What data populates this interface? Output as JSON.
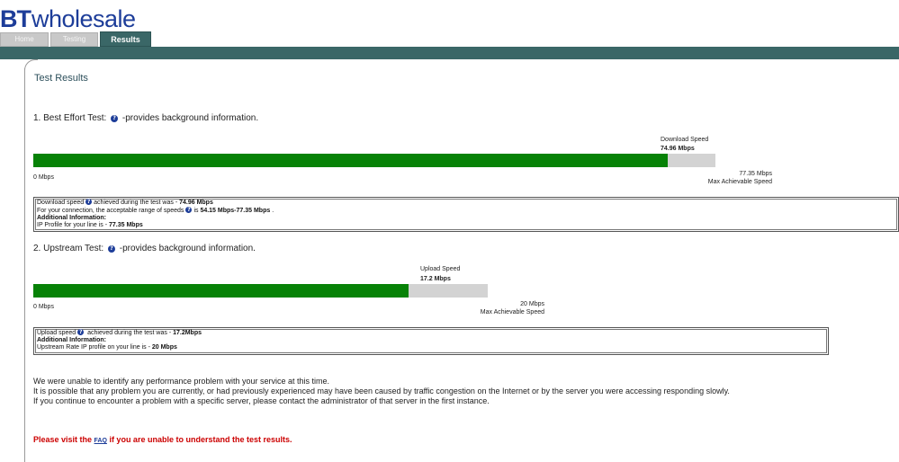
{
  "brand": {
    "bt": "BT",
    "wholesale": "wholesale"
  },
  "tabs": {
    "home": "Home",
    "testing": "Testing",
    "results": "Results"
  },
  "page_title": "Test Results",
  "download": {
    "title": "1. Best Effort Test:",
    "title_suffix": "-provides background information.",
    "speed_label": "Download Speed",
    "speed_value": "74.96 Mbps",
    "measured_mbps": 74.96,
    "max_mbps": 77.35,
    "scale_min": "0 Mbps",
    "scale_max": "77.35 Mbps",
    "scale_max_caption": "Max Achievable Speed",
    "info": {
      "l1_pre": "Download speed",
      "l1_mid": "achieved during the test was - ",
      "l1_val": "74.96 Mbps",
      "l2_pre": "For your connection, the acceptable range of speeds",
      "l2_mid": "is ",
      "l2_val": "54.15 Mbps-77.35 Mbps",
      "l2_end": " .",
      "l3": "Additional Information:",
      "l4_pre": "IP Profile for your line is - ",
      "l4_val": "77.35 Mbps"
    }
  },
  "upload": {
    "title": "2. Upstream Test:",
    "title_suffix": "-provides background information.",
    "speed_label": "Upload Speed",
    "speed_value": "17.2 Mbps",
    "measured_mbps": 17.2,
    "max_mbps": 20,
    "scale_min": "0 Mbps",
    "scale_max": "20 Mbps",
    "scale_max_caption": "Max Achievable Speed",
    "info": {
      "l1_pre": "Upload speed",
      "l1_mid": " achieved during the test was - ",
      "l1_val": "17.2Mbps",
      "l2": "Additional Information:",
      "l3_pre": "Upstream Rate IP profile on your line is - ",
      "l3_val": "20 Mbps"
    }
  },
  "summary": {
    "line1": "We were unable to identify any performance problem with your service at this time.",
    "line2": "It is possible that any problem you are currently, or had previously experienced may have been caused by traffic congestion on the Internet or by the server you were accessing responding slowly.",
    "line3": "If you continue to encounter a problem with a specific server, please contact the administrator of that server in the first instance."
  },
  "faq": {
    "pre": "Please visit the ",
    "link": "FAQ",
    "post": " if you are unable to understand the test results."
  },
  "colors": {
    "brand_blue": "#1d3d99",
    "band_teal": "#3a6767",
    "bar_green": "#078207",
    "bar_track": "#d3d3d3",
    "alert_red": "#cc0000"
  }
}
